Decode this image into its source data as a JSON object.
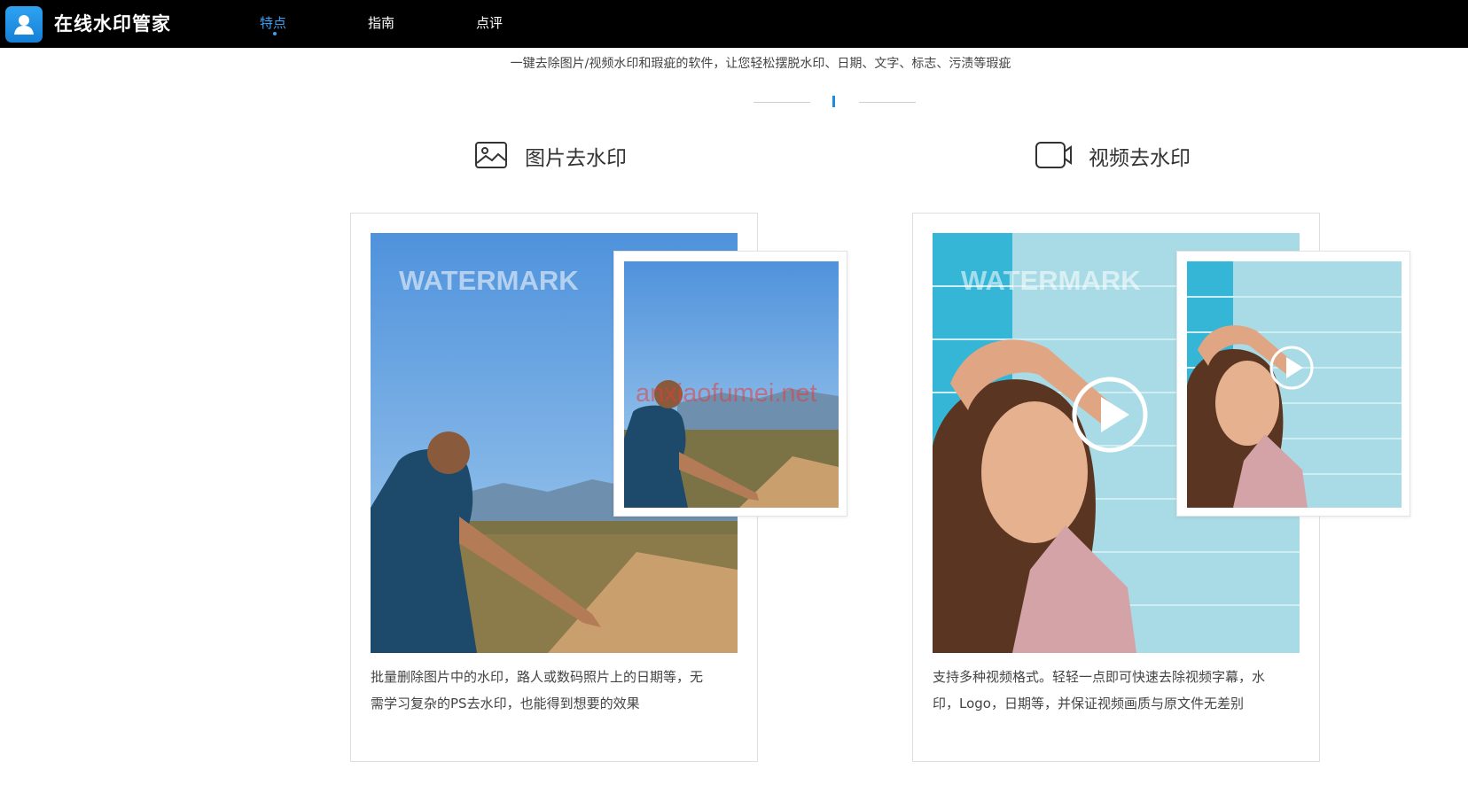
{
  "header": {
    "brand": "在线水印管家",
    "nav": [
      {
        "label": "特点",
        "active": true
      },
      {
        "label": "指南",
        "active": false
      },
      {
        "label": "点评",
        "active": false
      }
    ]
  },
  "intro": {
    "subtitle": "一键去除图片/视频水印和瑕疵的软件，让您轻松摆脱水印、日期、文字、标志、污渍等瑕疵"
  },
  "features": [
    {
      "title": "图片去水印",
      "icon": "image-icon",
      "watermark_text": "WATERMARK",
      "description_line1": "批量删除图片中的水印，路人或数码照片上的日期等，无",
      "description_line2": "需学习复杂的PS去水印，也能得到想要的效果"
    },
    {
      "title": "视频去水印",
      "icon": "video-camera-icon",
      "watermark_text": "WATERMARK",
      "description_line1": "支持多种视频格式。轻轻一点即可快速去除视频字幕，水",
      "description_line2": "印，Logo，日期等，并保证视频画质与原文件无差别"
    }
  ],
  "overlay_watermark": "anxiaofumei.net",
  "colors": {
    "topbar": "#000000",
    "accent": "#3ea0ef",
    "divider_mark": "#1e8be0"
  }
}
